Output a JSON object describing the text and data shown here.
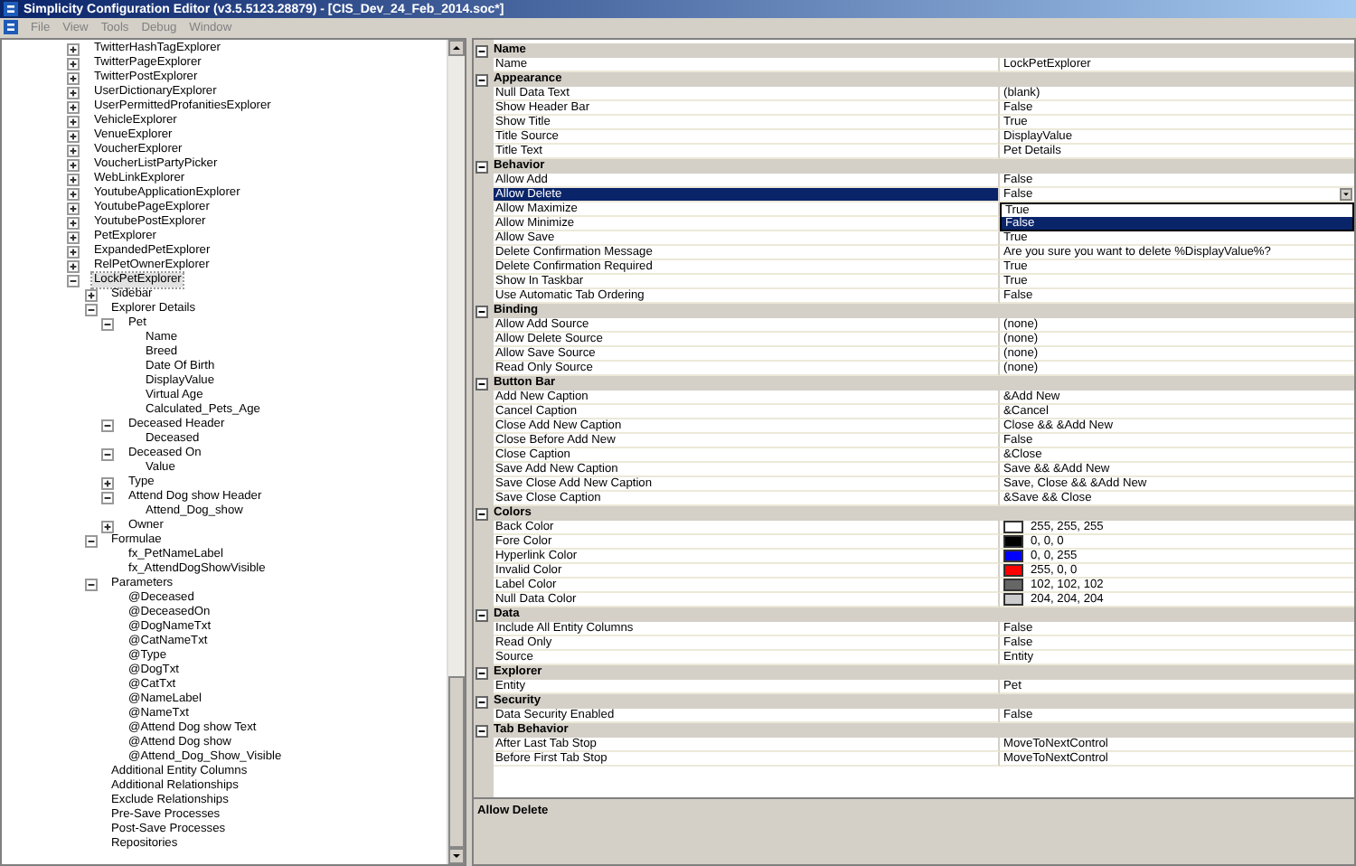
{
  "window": {
    "title": "Simplicity Configuration Editor (v3.5.5123.28879) - [CIS_Dev_24_Feb_2014.soc*]"
  },
  "menu": [
    "File",
    "View",
    "Tools",
    "Debug",
    "Window"
  ],
  "tree": [
    {
      "label": "TwitterHashTagExplorer",
      "expanded": false,
      "selected": false
    },
    {
      "label": "TwitterPageExplorer",
      "expanded": false,
      "selected": false
    },
    {
      "label": "TwitterPostExplorer",
      "expanded": false,
      "selected": false
    },
    {
      "label": "UserDictionaryExplorer",
      "expanded": false,
      "selected": false
    },
    {
      "label": "UserPermittedProfanitiesExplorer",
      "expanded": false,
      "selected": false
    },
    {
      "label": "VehicleExplorer",
      "expanded": false,
      "selected": false
    },
    {
      "label": "VenueExplorer",
      "expanded": false,
      "selected": false
    },
    {
      "label": "VoucherExplorer",
      "expanded": false,
      "selected": false
    },
    {
      "label": "VoucherListPartyPicker",
      "expanded": false,
      "selected": false
    },
    {
      "label": "WebLinkExplorer",
      "expanded": false,
      "selected": false
    },
    {
      "label": "YoutubeApplicationExplorer",
      "expanded": false,
      "selected": false
    },
    {
      "label": "YoutubePageExplorer",
      "expanded": false,
      "selected": false
    },
    {
      "label": "YoutubePostExplorer",
      "expanded": false,
      "selected": false
    },
    {
      "label": "PetExplorer",
      "expanded": false,
      "selected": false
    },
    {
      "label": "ExpandedPetExplorer",
      "expanded": false,
      "selected": false
    },
    {
      "label": "RelPetOwnerExplorer",
      "expanded": false,
      "selected": false
    },
    {
      "label": "LockPetExplorer",
      "expanded": true,
      "selected": true,
      "children": [
        {
          "label": "Sidebar",
          "expanded": false,
          "selected": false
        },
        {
          "label": "Explorer Details",
          "expanded": true,
          "selected": false,
          "children": [
            {
              "label": "Pet",
              "expanded": true,
              "selected": false,
              "children": [
                {
                  "label": "Name",
                  "selected": false
                },
                {
                  "label": "Breed",
                  "selected": false
                },
                {
                  "label": "Date Of Birth",
                  "selected": false
                },
                {
                  "label": "DisplayValue",
                  "selected": false
                },
                {
                  "label": "Virtual Age",
                  "selected": false
                },
                {
                  "label": "Calculated_Pets_Age",
                  "selected": false
                }
              ]
            },
            {
              "label": "Deceased Header",
              "expanded": true,
              "selected": false,
              "children": [
                {
                  "label": "Deceased",
                  "selected": false
                }
              ]
            },
            {
              "label": "Deceased On",
              "expanded": true,
              "selected": false,
              "children": [
                {
                  "label": "Value",
                  "selected": false
                }
              ]
            },
            {
              "label": "Type",
              "expanded": false,
              "selected": false
            },
            {
              "label": "Attend Dog show Header",
              "expanded": true,
              "selected": false,
              "children": [
                {
                  "label": "Attend_Dog_show",
                  "selected": false
                }
              ]
            },
            {
              "label": "Owner",
              "expanded": false,
              "selected": false
            }
          ]
        },
        {
          "label": "Formulae",
          "expanded": true,
          "selected": false,
          "children": [
            {
              "label": "fx_PetNameLabel",
              "selected": false
            },
            {
              "label": "fx_AttendDogShowVisible",
              "selected": false
            }
          ]
        },
        {
          "label": "Parameters",
          "expanded": true,
          "selected": false,
          "children": [
            {
              "label": "@Deceased",
              "selected": false
            },
            {
              "label": "@DeceasedOn",
              "selected": false
            },
            {
              "label": "@DogNameTxt",
              "selected": false
            },
            {
              "label": "@CatNameTxt",
              "selected": false
            },
            {
              "label": "@Type",
              "selected": false
            },
            {
              "label": "@DogTxt",
              "selected": false
            },
            {
              "label": "@CatTxt",
              "selected": false
            },
            {
              "label": "@NameLabel",
              "selected": false
            },
            {
              "label": "@NameTxt",
              "selected": false
            },
            {
              "label": "@Attend Dog show Text",
              "selected": false
            },
            {
              "label": "@Attend Dog show",
              "selected": false
            },
            {
              "label": "@Attend_Dog_Show_Visible",
              "selected": false
            }
          ]
        },
        {
          "label": "Additional Entity Columns",
          "selected": false
        },
        {
          "label": "Additional Relationships",
          "selected": false
        },
        {
          "label": "Exclude Relationships",
          "selected": false
        },
        {
          "label": "Pre-Save Processes",
          "selected": false
        },
        {
          "label": "Post-Save Processes",
          "selected": false
        },
        {
          "label": "Repositories",
          "selected": false
        }
      ]
    }
  ],
  "properties": [
    {
      "name": "Name",
      "expanded": true,
      "rows": [
        {
          "kind": "text",
          "name": "Name",
          "value": "LockPetExplorer",
          "selected": false
        }
      ]
    },
    {
      "name": "Appearance",
      "expanded": true,
      "rows": [
        {
          "kind": "text",
          "name": "Null Data Text",
          "value": "(blank)",
          "selected": false
        },
        {
          "kind": "text",
          "name": "Show Header Bar",
          "value": "False",
          "selected": false
        },
        {
          "kind": "text",
          "name": "Show Title",
          "value": "True",
          "selected": false
        },
        {
          "kind": "text",
          "name": "Title Source",
          "value": "DisplayValue",
          "selected": false
        },
        {
          "kind": "text",
          "name": "Title Text",
          "value": "Pet Details",
          "selected": false
        }
      ]
    },
    {
      "name": "Behavior",
      "expanded": true,
      "rows": [
        {
          "kind": "text",
          "name": "Allow Add",
          "value": "False",
          "selected": false
        },
        {
          "kind": "text",
          "name": "Allow Delete",
          "value": "False",
          "selected": true,
          "dropdown": [
            {
              "label": "True",
              "selected": false
            },
            {
              "label": "False",
              "selected": true
            }
          ]
        },
        {
          "kind": "text",
          "name": "Allow Maximize",
          "selected": false
        },
        {
          "kind": "text",
          "name": "Allow Minimize",
          "selected": false
        },
        {
          "kind": "text",
          "name": "Allow Save",
          "value": "True",
          "selected": false
        },
        {
          "kind": "text",
          "name": "Delete Confirmation Message",
          "value": "Are you sure you want to delete %DisplayValue%?",
          "selected": false
        },
        {
          "kind": "text",
          "name": "Delete Confirmation Required",
          "value": "True",
          "selected": false
        },
        {
          "kind": "text",
          "name": "Show In Taskbar",
          "value": "True",
          "selected": false
        },
        {
          "kind": "text",
          "name": "Use Automatic Tab Ordering",
          "value": "False",
          "selected": false
        }
      ]
    },
    {
      "name": "Binding",
      "expanded": true,
      "rows": [
        {
          "kind": "text",
          "name": "Allow Add Source",
          "value": "(none)",
          "selected": false
        },
        {
          "kind": "text",
          "name": "Allow Delete Source",
          "value": "(none)",
          "selected": false
        },
        {
          "kind": "text",
          "name": "Allow Save Source",
          "value": "(none)",
          "selected": false
        },
        {
          "kind": "text",
          "name": "Read Only Source",
          "value": "(none)",
          "selected": false
        }
      ]
    },
    {
      "name": "Button Bar",
      "expanded": true,
      "rows": [
        {
          "kind": "text",
          "name": "Add New Caption",
          "value": "&Add New",
          "selected": false
        },
        {
          "kind": "text",
          "name": "Cancel Caption",
          "value": "&Cancel",
          "selected": false
        },
        {
          "kind": "text",
          "name": "Close Add New Caption",
          "value": "Close && &Add New",
          "selected": false
        },
        {
          "kind": "text",
          "name": "Close Before Add New",
          "value": "False",
          "selected": false
        },
        {
          "kind": "text",
          "name": "Close Caption",
          "value": "&Close",
          "selected": false
        },
        {
          "kind": "text",
          "name": "Save Add New Caption",
          "value": "Save && &Add New",
          "selected": false
        },
        {
          "kind": "text",
          "name": "Save Close Add New Caption",
          "value": "Save, Close && &Add New",
          "selected": false
        },
        {
          "kind": "text",
          "name": "Save Close Caption",
          "value": "&Save && Close",
          "selected": false
        }
      ]
    },
    {
      "name": "Colors",
      "expanded": true,
      "rows": [
        {
          "kind": "color",
          "name": "Back Color",
          "value": "255, 255, 255",
          "color": "#ffffff",
          "selected": false
        },
        {
          "kind": "color",
          "name": "Fore Color",
          "value": "0, 0, 0",
          "color": "#000000",
          "selected": false
        },
        {
          "kind": "color",
          "name": "Hyperlink Color",
          "value": "0, 0, 255",
          "color": "#0000ff",
          "selected": false
        },
        {
          "kind": "color",
          "name": "Invalid Color",
          "value": "255, 0, 0",
          "color": "#ff0000",
          "selected": false
        },
        {
          "kind": "color",
          "name": "Label Color",
          "value": "102, 102, 102",
          "color": "#666666",
          "selected": false
        },
        {
          "kind": "color",
          "name": "Null Data Color",
          "value": "204, 204, 204",
          "color": "#cccccc",
          "selected": false
        }
      ]
    },
    {
      "name": "Data",
      "expanded": true,
      "rows": [
        {
          "kind": "text",
          "name": "Include All Entity Columns",
          "value": "False",
          "selected": false
        },
        {
          "kind": "text",
          "name": "Read Only",
          "value": "False",
          "selected": false
        },
        {
          "kind": "text",
          "name": "Source",
          "value": "Entity",
          "selected": false
        }
      ]
    },
    {
      "name": "Explorer",
      "expanded": true,
      "rows": [
        {
          "kind": "text",
          "name": "Entity",
          "value": "Pet",
          "selected": false
        }
      ]
    },
    {
      "name": "Security",
      "expanded": true,
      "rows": [
        {
          "kind": "text",
          "name": "Data Security Enabled",
          "value": "False",
          "selected": false
        }
      ]
    },
    {
      "name": "Tab Behavior",
      "expanded": true,
      "rows": [
        {
          "kind": "text",
          "name": "After Last Tab Stop",
          "value": "MoveToNextControl",
          "selected": false
        },
        {
          "kind": "text",
          "name": "Before First Tab Stop",
          "value": "MoveToNextControl",
          "selected": false
        }
      ]
    }
  ],
  "description": {
    "title": "Allow Delete"
  }
}
